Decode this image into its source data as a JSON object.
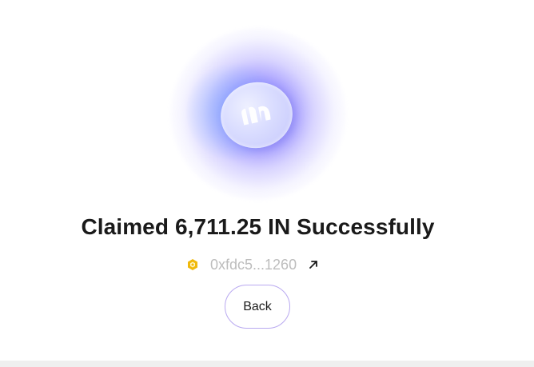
{
  "dialog": {
    "title": "Claimed 6,711.25 IN Successfully",
    "address": "0xfdc5...1260",
    "back_label": "Back"
  },
  "icons": {
    "hero": "coin-icon",
    "chain": "bnb-chain-icon",
    "external": "external-link-arrow-icon"
  },
  "colors": {
    "accent_border": "#b9a9f0",
    "glow": "#8c82ff",
    "chain": "#f0b90b",
    "address_text": "#bdbdbd"
  }
}
